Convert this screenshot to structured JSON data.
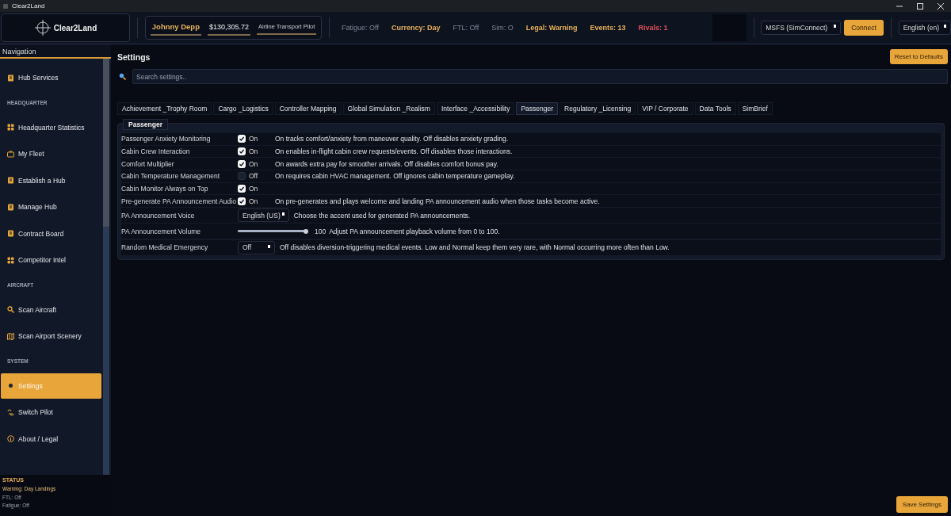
{
  "window": {
    "title": "Clear2Land"
  },
  "header": {
    "logo": "Clear2Land",
    "pilot": {
      "name": "Johnny Depp",
      "balance": "$130,305.72",
      "rank": "Airline Transport Pilot"
    },
    "stats": [
      {
        "text": "Fatigue: Off",
        "kind": "muted"
      },
      {
        "text": "Currency: Day",
        "kind": "warning"
      },
      {
        "text": "FTL: Off",
        "kind": "muted"
      },
      {
        "text": "Sim: O",
        "kind": "muted"
      },
      {
        "text": "Legal: Warning",
        "kind": "warning"
      },
      {
        "text": "Events: 13",
        "kind": "warning"
      },
      {
        "text": "Rivals: 1",
        "kind": "alert"
      }
    ],
    "sim_select": "MSFS (SimConnect)",
    "connect_button": "Connect",
    "language_select": "English (en)"
  },
  "sidebar": {
    "title": "Navigation",
    "sections": [
      {
        "items": [
          {
            "label": "Hub Services",
            "selected": false
          }
        ]
      },
      {
        "heading": "HEADQUARTER",
        "items": [
          {
            "label": "Headquarter Statistics",
            "selected": false
          },
          {
            "label": "My Fleet",
            "selected": false
          },
          {
            "label": "Establish a Hub",
            "selected": false
          },
          {
            "label": "Manage Hub",
            "selected": false
          },
          {
            "label": "Contract Board",
            "selected": false
          },
          {
            "label": "Competitor Intel",
            "selected": false
          }
        ]
      },
      {
        "heading": "AIRCRAFT",
        "items": [
          {
            "label": "Scan Aircraft",
            "selected": false
          },
          {
            "label": "Scan Airport Scenery",
            "selected": false
          }
        ]
      },
      {
        "heading": "SYSTEM",
        "items": [
          {
            "label": "Settings",
            "selected": true
          },
          {
            "label": "Switch Pilot",
            "selected": false
          },
          {
            "label": "About / Legal",
            "selected": false
          }
        ]
      }
    ],
    "status": {
      "heading": "STATUS",
      "lines": [
        "Warning: Day Landings",
        "FTL: Off",
        "Fatigue: Off"
      ]
    }
  },
  "main": {
    "title": "Settings",
    "reset_button": "Reset to Defaults",
    "search": {
      "placeholder": "Search settings.."
    },
    "tabs": [
      {
        "label": "Achievement _Trophy Room",
        "selected": false
      },
      {
        "label": "Cargo _Logistics",
        "selected": false
      },
      {
        "label": "Controller Mapping",
        "selected": false
      },
      {
        "label": "Global Simulation _Realism",
        "selected": false
      },
      {
        "label": "Interface _Accessibility",
        "selected": false
      },
      {
        "label": "Passenger",
        "selected": true
      },
      {
        "label": "Regulatory _Licensing",
        "selected": false
      },
      {
        "label": "VIP / Corporate",
        "selected": false
      },
      {
        "label": "Data Tools",
        "selected": false
      },
      {
        "label": "SimBrief",
        "selected": false
      }
    ],
    "group": {
      "title": "Passenger",
      "settings": [
        {
          "kind": "toggle",
          "label": "Passenger Anxiety Monitoring",
          "checked": true,
          "state": "On",
          "description": "On tracks comfort/anxiety from maneuver quality. Off disables anxiety grading."
        },
        {
          "kind": "toggle",
          "label": "Cabin Crew Interaction",
          "checked": true,
          "state": "On",
          "description": "On enables in-flight cabin crew requests/events. Off disables those interactions."
        },
        {
          "kind": "toggle",
          "label": "Comfort Multiplier",
          "checked": true,
          "state": "On",
          "description": "On awards extra pay for smoother arrivals. Off disables comfort bonus pay."
        },
        {
          "kind": "toggle",
          "label": "Cabin Temperature Management",
          "checked": false,
          "state": "Off",
          "description": "On requires cabin HVAC management. Off ignores cabin temperature gameplay."
        },
        {
          "kind": "toggle",
          "label": "Cabin Monitor Always on Top",
          "checked": true,
          "state": "On"
        },
        {
          "kind": "toggle",
          "label": "Pre-generate PA Announcement Audio",
          "checked": true,
          "state": "On",
          "description": "On pre-generates and plays welcome and landing PA announcement audio when those tasks become active."
        },
        {
          "kind": "select",
          "label": "PA Announcement Voice",
          "value": "English (US)",
          "description": "Choose the accent used for generated PA announcements."
        },
        {
          "kind": "slider",
          "label": "PA Announcement Volume",
          "level": 1,
          "reading": "100",
          "description": "Adjust PA announcement playback volume from 0 to 100."
        },
        {
          "kind": "select",
          "label": "Random Medical Emergency",
          "value": "Off",
          "description": "Off disables diversion-triggering medical events. Low and Normal keep them very rare, with Normal occurring more often than Low."
        }
      ]
    }
  },
  "save_button": "Save Settings"
}
